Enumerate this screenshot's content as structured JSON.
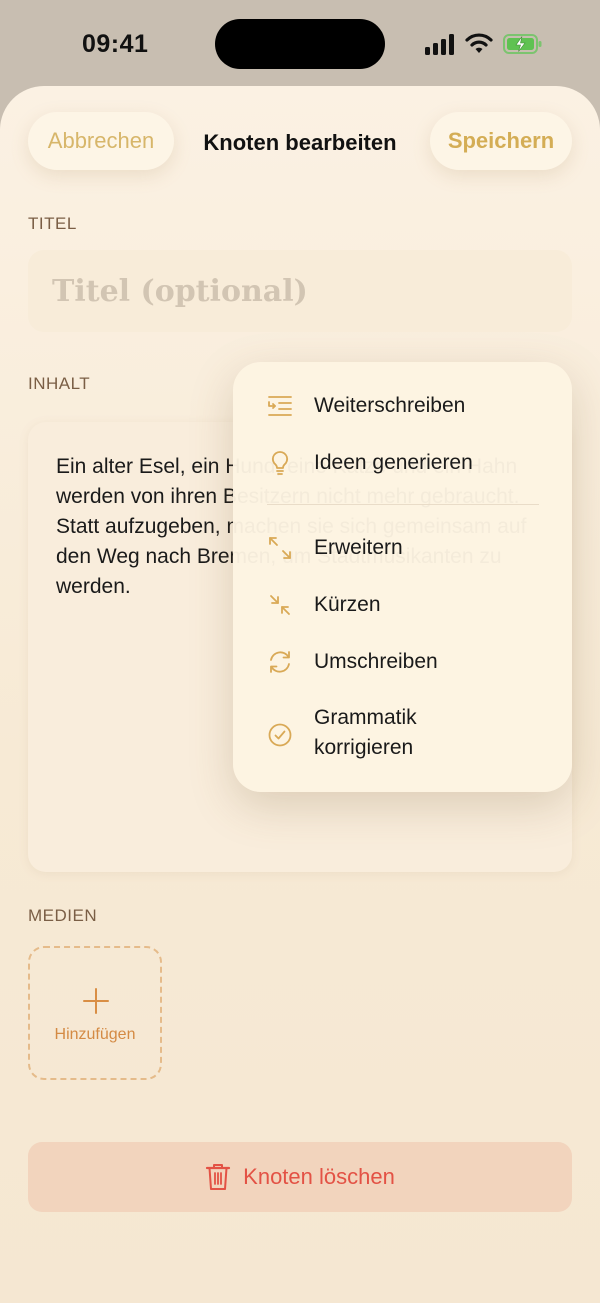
{
  "status_bar": {
    "time": "09:41"
  },
  "header": {
    "cancel_label": "Abbrechen",
    "title": "Knoten bearbeiten",
    "save_label": "Speichern"
  },
  "title_section": {
    "label": "TITEL",
    "placeholder": "Titel (optional)",
    "value": ""
  },
  "content_section": {
    "label": "INHALT",
    "text": "Ein alter Esel, ein Hund, eine Katze und ein Hahn werden von ihren Besitzern nicht mehr gebraucht. Statt aufzugeben, machen sie sich gemeinsam auf den Weg nach Bremen, um Stadtmusikanten zu werden."
  },
  "media_section": {
    "label": "MEDIEN",
    "add_label": "Hinzufügen"
  },
  "delete_label": "Knoten löschen",
  "ai_menu": {
    "items": [
      {
        "label": "Weiterschreiben",
        "icon": "continue-writing-icon"
      },
      {
        "label": "Ideen generieren",
        "icon": "lightbulb-icon"
      },
      {
        "label": "Erweitern",
        "icon": "expand-icon"
      },
      {
        "label": "Kürzen",
        "icon": "shorten-icon"
      },
      {
        "label": "Umschreiben",
        "icon": "rewrite-icon"
      },
      {
        "label": "Grammatik korrigieren",
        "icon": "checkmark-circle-icon"
      }
    ]
  },
  "colors": {
    "accent": "#d4ad55",
    "icon_accent": "#d9a956",
    "destructive": "#e35245",
    "delete_bg": "#f2d4bd"
  }
}
